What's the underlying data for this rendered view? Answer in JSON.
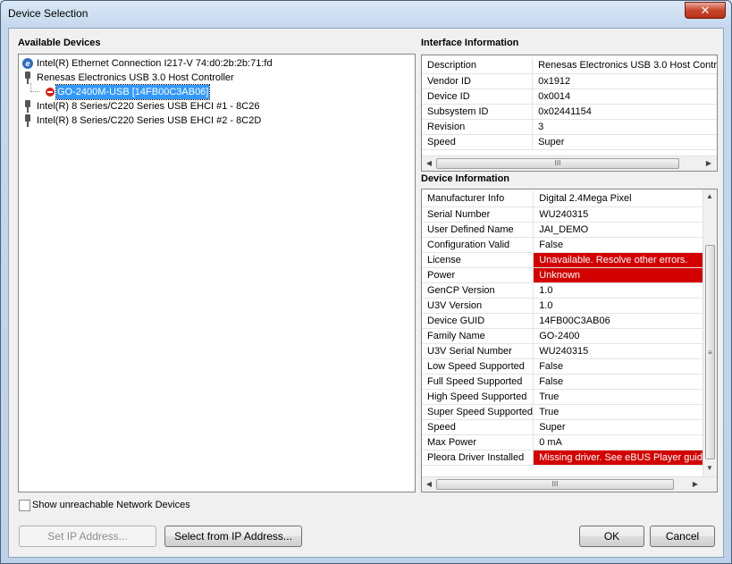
{
  "window": {
    "title": "Device Selection",
    "close_glyph": "✕"
  },
  "available_devices": {
    "title": "Available Devices",
    "items": [
      {
        "label": "Intel(R) Ethernet Connection I217-V 74:d0:2b:2b:71:fd",
        "icon": "ethernet-icon"
      },
      {
        "label": "Renesas Electronics USB 3.0 Host Controller",
        "icon": "usb-icon"
      },
      {
        "label": "GO-2400M-USB [14FB00C3AB06]",
        "icon": "error-icon",
        "selected": true
      },
      {
        "label": "Intel(R) 8 Series/C220 Series USB EHCI #1 - 8C26",
        "icon": "usb-icon"
      },
      {
        "label": "Intel(R) 8 Series/C220 Series USB EHCI #2 - 8C2D",
        "icon": "usb-icon"
      }
    ]
  },
  "interface_information": {
    "title": "Interface Information",
    "rows": [
      {
        "key": "Description",
        "value": "Renesas Electronics USB 3.0 Host Contr"
      },
      {
        "key": "Vendor ID",
        "value": "0x1912"
      },
      {
        "key": "Device ID",
        "value": "0x0014"
      },
      {
        "key": "Subsystem ID",
        "value": "0x02441154"
      },
      {
        "key": "Revision",
        "value": "3"
      },
      {
        "key": "Speed",
        "value": "Super"
      }
    ],
    "scroll_grip": "III"
  },
  "device_information": {
    "title": "Device Information",
    "rows": [
      {
        "key": "Manufacturer Info",
        "value": "Digital 2.4Mega Pixel"
      },
      {
        "key": "Serial Number",
        "value": "WU240315"
      },
      {
        "key": "User Defined Name",
        "value": "JAI_DEMO"
      },
      {
        "key": "Configuration Valid",
        "value": "False"
      },
      {
        "key": "License",
        "value": "Unavailable. Resolve other errors.",
        "error": true
      },
      {
        "key": "Power",
        "value": "Unknown",
        "error": true
      },
      {
        "key": "GenCP Version",
        "value": "1.0"
      },
      {
        "key": "U3V Version",
        "value": "1.0"
      },
      {
        "key": "Device GUID",
        "value": "14FB00C3AB06"
      },
      {
        "key": "Family Name",
        "value": "GO-2400"
      },
      {
        "key": "U3V Serial Number",
        "value": "WU240315"
      },
      {
        "key": "Low Speed Supported",
        "value": "False"
      },
      {
        "key": "Full Speed Supported",
        "value": "False"
      },
      {
        "key": "High Speed Supported",
        "value": "True"
      },
      {
        "key": "Super Speed Supported",
        "value": "True"
      },
      {
        "key": "Speed",
        "value": "Super"
      },
      {
        "key": "Max Power",
        "value": "0 mA"
      },
      {
        "key": "Pleora Driver Installed",
        "value": "Missing driver. See eBUS Player guid",
        "error": true
      }
    ],
    "scroll_grip": "III",
    "vscroll_grip": "≡"
  },
  "options": {
    "show_unreachable_label": "Show unreachable Network Devices",
    "show_unreachable_checked": false
  },
  "buttons": {
    "set_ip": "Set IP Address...",
    "select_from_ip": "Select from IP Address...",
    "ok": "OK",
    "cancel": "Cancel"
  },
  "colors": {
    "error_bg": "#d40000",
    "selection": "#3399ff"
  }
}
